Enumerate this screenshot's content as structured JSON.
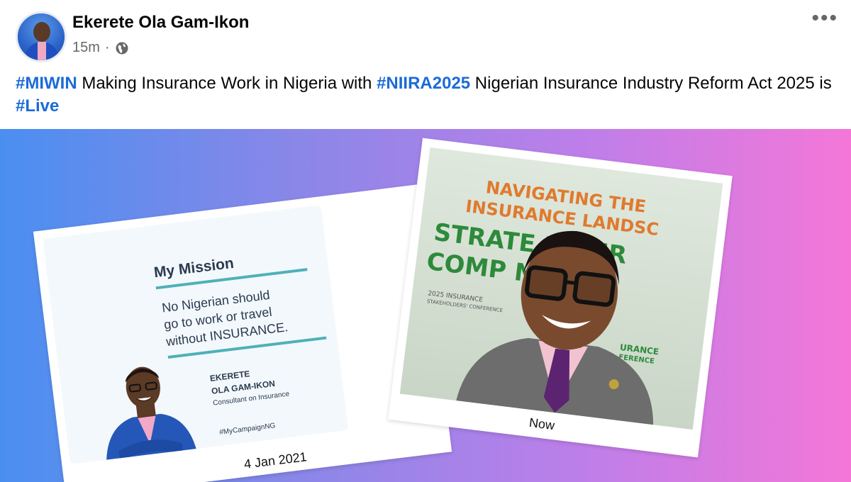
{
  "post": {
    "author": "Ekerete Ola Gam-Ikon",
    "time": "15m",
    "separator": "·",
    "more": "•••",
    "text": {
      "tag1": "#MIWIN",
      "part1": " Making Insurance Work in Nigeria with ",
      "tag2": "#NIIRA2025",
      "part2": " Nigerian Insurance Industry Reform Act 2025 is ",
      "tag3": "#Live"
    }
  },
  "card_left": {
    "title": "My Mission",
    "line1": "No Nigerian should",
    "line2": "go to work or travel",
    "line3": "without INSURANCE.",
    "name1": "EKERETE",
    "name2": "OLA GAM-IKON",
    "role": "Consultant on Insurance",
    "hashtag": "#MyCampaignNG",
    "caption": "4 Jan 2021"
  },
  "card_right": {
    "banner1": "NAVIGATING THE",
    "banner2": "INSURANCE LANDSC",
    "banner3": "STRATE     R NIIR",
    "banner4": "COMP        ND G",
    "conf1": "2025 INSURANCE",
    "conf2": "STAKEHOLDERS' CONFERENCE",
    "badge1": "URANCE",
    "badge2": "FERENCE",
    "caption": "Now"
  },
  "colors": {
    "hashtag": "#1b6bd7",
    "gradient_start": "#4a8ff0",
    "gradient_end": "#f477d8"
  }
}
